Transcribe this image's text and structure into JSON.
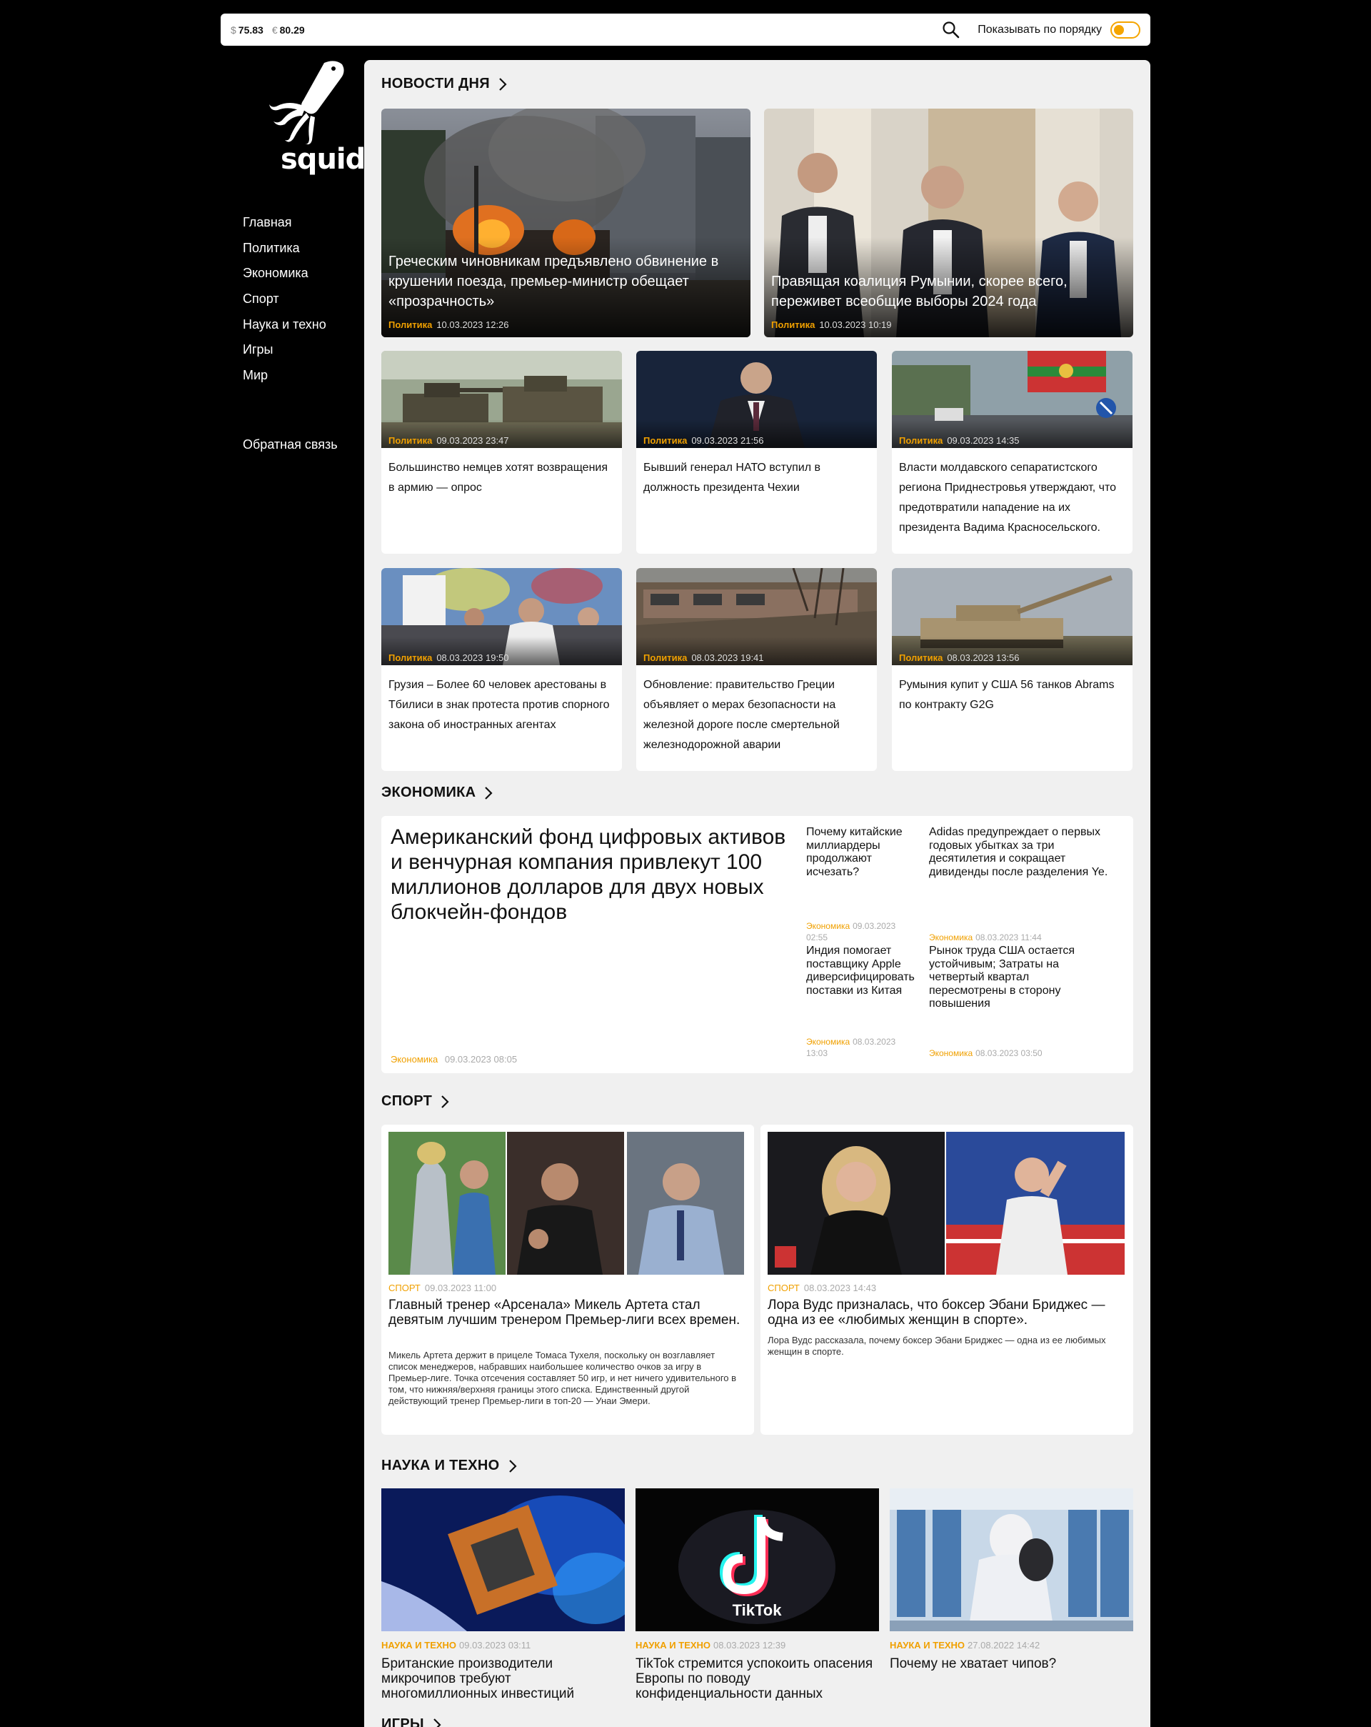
{
  "topbar": {
    "usd_symbol": "$",
    "usd_value": "75.83",
    "eur_symbol": "€",
    "eur_value": "80.29",
    "search_icon": "search-icon",
    "order_label": "Показывать по порядку",
    "order_toggle": false
  },
  "colors": {
    "accent": "#f0a000",
    "background": "#000000",
    "panel": "#f0f0f0"
  },
  "sidebar": {
    "logo": "squid",
    "nav": [
      "Главная",
      "Политика",
      "Экономика",
      "Спорт",
      "Наука и техно",
      "Игры",
      "Мир"
    ],
    "feedback": "Обратная связь"
  },
  "news": {
    "heading": "НОВОСТИ ДНЯ",
    "hero": [
      {
        "title": "Греческим чиновникам предъявлено обвинение в крушении поезда, премьер-министр обещает «прозрачность»",
        "category": "Политика",
        "date": "10.03.2023 12:26"
      },
      {
        "title": "Правящая коалиция Румынии, скорее всего, переживет всеобщие выборы 2024 года",
        "category": "Политика",
        "date": "10.03.2023 10:19"
      }
    ],
    "cards": [
      {
        "title": "Большинство немцев хотят возвращения в армию — опрос",
        "category": "Политика",
        "date": "09.03.2023 23:47"
      },
      {
        "title": "Бывший генерал НАТО вступил в должность президента Чехии",
        "category": "Политика",
        "date": "09.03.2023 21:56"
      },
      {
        "title": "Власти молдавского сепаратистского региона Приднестровья утверждают, что предотвратили нападение на их президента Вадима Красносельского.",
        "category": "Политика",
        "date": "09.03.2023 14:35"
      },
      {
        "title": "Грузия – Более 60 человек арестованы в Тбилиси в знак протеста против спорного закона об иностранных агентах",
        "category": "Политика",
        "date": "08.03.2023 19:50"
      },
      {
        "title": "Обновление: правительство Греции объявляет о мерах безопасности на железной дороге после смертельной железнодорожной аварии",
        "category": "Политика",
        "date": "08.03.2023 19:41"
      },
      {
        "title": "Румыния купит у США 56 танков Abrams по контракту G2G",
        "category": "Политика",
        "date": "08.03.2023 13:56"
      }
    ]
  },
  "economy": {
    "heading": "ЭКОНОМИКА",
    "main": {
      "title": "Американский фонд цифровых активов и венчурная компания привлекут 100 миллионов долларов для двух новых блокчейн-фондов",
      "category": "Экономика",
      "date": "09.03.2023 08:05"
    },
    "items": [
      {
        "title": "Почему китайские миллиардеры продолжают исчезать?",
        "category": "Экономика",
        "date": "09.03.2023 02:55"
      },
      {
        "title": "Adidas предупреждает о первых годовых убытках за три десятилетия и сокращает дивиденды после разделения Ye.",
        "category": "Экономика",
        "date": "08.03.2023 11:44"
      },
      {
        "title": "Индия помогает поставщику Apple диверсифицировать поставки из Китая",
        "category": "Экономика",
        "date": "08.03.2023 13:03"
      },
      {
        "title": "Рынок труда США остается устойчивым; Затраты на четвертый квартал пересмотрены в сторону повышения",
        "category": "Экономика",
        "date": "08.03.2023 03:50"
      }
    ]
  },
  "sport": {
    "heading": "СПОРТ",
    "cards": [
      {
        "category": "СПОРТ",
        "date": "09.03.2023 11:00",
        "title": "Главный тренер «Арсенала» Микель Артета стал девятым лучшим тренером Премьер-лиги всех времен.",
        "desc": "Микель Артета держит в прицеле Томаса Тухеля, поскольку он возглавляет список менеджеров, набравших наибольшее количество очков за игру в Премьер-лиге. Точка отсечения составляет 50 игр, и нет ничего удивительного в том, что нижняя/верхняя границы этого списка. Единственный другой действующий тренер Премьер-лиги в топ-20 — Унаи Эмери."
      },
      {
        "category": "СПОРТ",
        "date": "08.03.2023 14:43",
        "title": "Лора Вудс призналась, что боксер Эбани Бриджес — одна из ее «любимых женщин в спорте».",
        "desc": "Лора Вудс рассказала, почему боксер Эбани Бриджес — одна из ее любимых женщин в спорте."
      }
    ]
  },
  "tech": {
    "heading": "НАУКА И ТЕХНО",
    "cards": [
      {
        "category": "НАУКА И ТЕХНО",
        "date": "09.03.2023 03:11",
        "title": "Британские производители микрочипов требуют многомиллионных инвестиций"
      },
      {
        "category": "НАУКА И ТЕХНО",
        "date": "08.03.2023 12:39",
        "title": "TikTok стремится успокоить опасения Европы по поводу конфиденциальности данных",
        "logo_text": "TikTok"
      },
      {
        "category": "НАУКА И ТЕХНО",
        "date": "27.08.2022 14:42",
        "title": "Почему не хватает чипов?"
      }
    ]
  },
  "games": {
    "heading": "ИГРЫ"
  }
}
